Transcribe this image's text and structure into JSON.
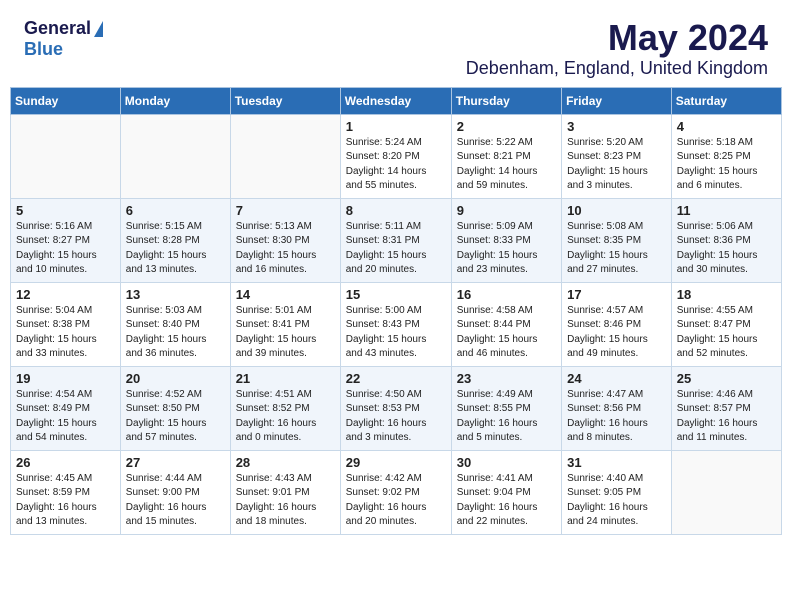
{
  "header": {
    "logo_general": "General",
    "logo_blue": "Blue",
    "month": "May 2024",
    "location": "Debenham, England, United Kingdom"
  },
  "days_of_week": [
    "Sunday",
    "Monday",
    "Tuesday",
    "Wednesday",
    "Thursday",
    "Friday",
    "Saturday"
  ],
  "weeks": [
    [
      {
        "day": "",
        "text": ""
      },
      {
        "day": "",
        "text": ""
      },
      {
        "day": "",
        "text": ""
      },
      {
        "day": "1",
        "text": "Sunrise: 5:24 AM\nSunset: 8:20 PM\nDaylight: 14 hours\nand 55 minutes."
      },
      {
        "day": "2",
        "text": "Sunrise: 5:22 AM\nSunset: 8:21 PM\nDaylight: 14 hours\nand 59 minutes."
      },
      {
        "day": "3",
        "text": "Sunrise: 5:20 AM\nSunset: 8:23 PM\nDaylight: 15 hours\nand 3 minutes."
      },
      {
        "day": "4",
        "text": "Sunrise: 5:18 AM\nSunset: 8:25 PM\nDaylight: 15 hours\nand 6 minutes."
      }
    ],
    [
      {
        "day": "5",
        "text": "Sunrise: 5:16 AM\nSunset: 8:27 PM\nDaylight: 15 hours\nand 10 minutes."
      },
      {
        "day": "6",
        "text": "Sunrise: 5:15 AM\nSunset: 8:28 PM\nDaylight: 15 hours\nand 13 minutes."
      },
      {
        "day": "7",
        "text": "Sunrise: 5:13 AM\nSunset: 8:30 PM\nDaylight: 15 hours\nand 16 minutes."
      },
      {
        "day": "8",
        "text": "Sunrise: 5:11 AM\nSunset: 8:31 PM\nDaylight: 15 hours\nand 20 minutes."
      },
      {
        "day": "9",
        "text": "Sunrise: 5:09 AM\nSunset: 8:33 PM\nDaylight: 15 hours\nand 23 minutes."
      },
      {
        "day": "10",
        "text": "Sunrise: 5:08 AM\nSunset: 8:35 PM\nDaylight: 15 hours\nand 27 minutes."
      },
      {
        "day": "11",
        "text": "Sunrise: 5:06 AM\nSunset: 8:36 PM\nDaylight: 15 hours\nand 30 minutes."
      }
    ],
    [
      {
        "day": "12",
        "text": "Sunrise: 5:04 AM\nSunset: 8:38 PM\nDaylight: 15 hours\nand 33 minutes."
      },
      {
        "day": "13",
        "text": "Sunrise: 5:03 AM\nSunset: 8:40 PM\nDaylight: 15 hours\nand 36 minutes."
      },
      {
        "day": "14",
        "text": "Sunrise: 5:01 AM\nSunset: 8:41 PM\nDaylight: 15 hours\nand 39 minutes."
      },
      {
        "day": "15",
        "text": "Sunrise: 5:00 AM\nSunset: 8:43 PM\nDaylight: 15 hours\nand 43 minutes."
      },
      {
        "day": "16",
        "text": "Sunrise: 4:58 AM\nSunset: 8:44 PM\nDaylight: 15 hours\nand 46 minutes."
      },
      {
        "day": "17",
        "text": "Sunrise: 4:57 AM\nSunset: 8:46 PM\nDaylight: 15 hours\nand 49 minutes."
      },
      {
        "day": "18",
        "text": "Sunrise: 4:55 AM\nSunset: 8:47 PM\nDaylight: 15 hours\nand 52 minutes."
      }
    ],
    [
      {
        "day": "19",
        "text": "Sunrise: 4:54 AM\nSunset: 8:49 PM\nDaylight: 15 hours\nand 54 minutes."
      },
      {
        "day": "20",
        "text": "Sunrise: 4:52 AM\nSunset: 8:50 PM\nDaylight: 15 hours\nand 57 minutes."
      },
      {
        "day": "21",
        "text": "Sunrise: 4:51 AM\nSunset: 8:52 PM\nDaylight: 16 hours\nand 0 minutes."
      },
      {
        "day": "22",
        "text": "Sunrise: 4:50 AM\nSunset: 8:53 PM\nDaylight: 16 hours\nand 3 minutes."
      },
      {
        "day": "23",
        "text": "Sunrise: 4:49 AM\nSunset: 8:55 PM\nDaylight: 16 hours\nand 5 minutes."
      },
      {
        "day": "24",
        "text": "Sunrise: 4:47 AM\nSunset: 8:56 PM\nDaylight: 16 hours\nand 8 minutes."
      },
      {
        "day": "25",
        "text": "Sunrise: 4:46 AM\nSunset: 8:57 PM\nDaylight: 16 hours\nand 11 minutes."
      }
    ],
    [
      {
        "day": "26",
        "text": "Sunrise: 4:45 AM\nSunset: 8:59 PM\nDaylight: 16 hours\nand 13 minutes."
      },
      {
        "day": "27",
        "text": "Sunrise: 4:44 AM\nSunset: 9:00 PM\nDaylight: 16 hours\nand 15 minutes."
      },
      {
        "day": "28",
        "text": "Sunrise: 4:43 AM\nSunset: 9:01 PM\nDaylight: 16 hours\nand 18 minutes."
      },
      {
        "day": "29",
        "text": "Sunrise: 4:42 AM\nSunset: 9:02 PM\nDaylight: 16 hours\nand 20 minutes."
      },
      {
        "day": "30",
        "text": "Sunrise: 4:41 AM\nSunset: 9:04 PM\nDaylight: 16 hours\nand 22 minutes."
      },
      {
        "day": "31",
        "text": "Sunrise: 4:40 AM\nSunset: 9:05 PM\nDaylight: 16 hours\nand 24 minutes."
      },
      {
        "day": "",
        "text": ""
      }
    ]
  ]
}
